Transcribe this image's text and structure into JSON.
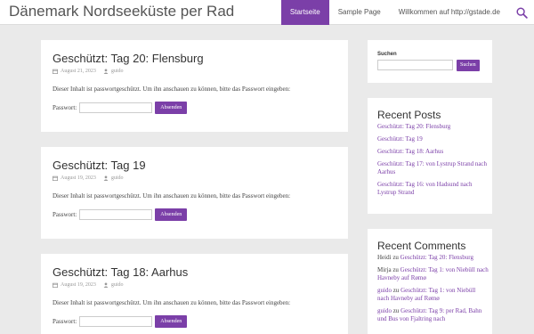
{
  "site": {
    "title": "Dänemark Nordseeküste per Rad"
  },
  "nav": {
    "items": [
      {
        "label": "Startseite"
      },
      {
        "label": "Sample Page"
      },
      {
        "label": "Willkommen auf http://gstade.de"
      }
    ],
    "search_icon": "search-icon"
  },
  "posts": [
    {
      "title": "Geschützt: Tag 20: Flensburg",
      "date": "August 21, 2023",
      "author": "guido",
      "text": "Dieser Inhalt ist passwortgeschützt. Um ihn anschauen zu können, bitte das Passwort eingeben:",
      "password_label": "Passwort:",
      "button": "Absenden"
    },
    {
      "title": "Geschützt: Tag 19",
      "date": "August 19, 2023",
      "author": "guido",
      "text": "Dieser Inhalt ist passwortgeschützt. Um ihn anschauen zu können, bitte das Passwort eingeben:",
      "password_label": "Passwort:",
      "button": "Absenden"
    },
    {
      "title": "Geschützt: Tag 18: Aarhus",
      "date": "August 19, 2023",
      "author": "guido",
      "text": "Dieser Inhalt ist passwortgeschützt. Um ihn anschauen zu können, bitte das Passwort eingeben:",
      "password_label": "Passwort:",
      "button": "Absenden"
    }
  ],
  "sidebar": {
    "search": {
      "label": "Suchen",
      "button": "Suchen",
      "placeholder": ""
    },
    "recent_posts": {
      "title": "Recent Posts",
      "items": [
        "Geschützt: Tag 20: Flensburg",
        "Geschützt: Tag 19",
        "Geschützt: Tag 18: Aarhus",
        "Geschützt: Tag 17: von Lystrup Strand nach Aarhus",
        "Geschützt: Tag 16: von Hadsund nach Lystrup Strand"
      ]
    },
    "recent_comments": {
      "title": "Recent Comments",
      "items": [
        {
          "author": "Heidi",
          "connector": "zu",
          "post": "Geschützt: Tag 20: Flensburg"
        },
        {
          "author": "Mirja",
          "connector": "zu",
          "post": "Geschützt: Tag 1: von Niebüll nach Havneby auf Rømø"
        },
        {
          "author": "guido",
          "connector": "zu",
          "post": "Geschützt: Tag 1: von Niebüll nach Havneby auf Rømø"
        },
        {
          "author": "guido",
          "connector": "zu",
          "post": "Geschützt: Tag 9: per Rad, Bahn und Bus von Fjaltring nach"
        }
      ]
    }
  }
}
